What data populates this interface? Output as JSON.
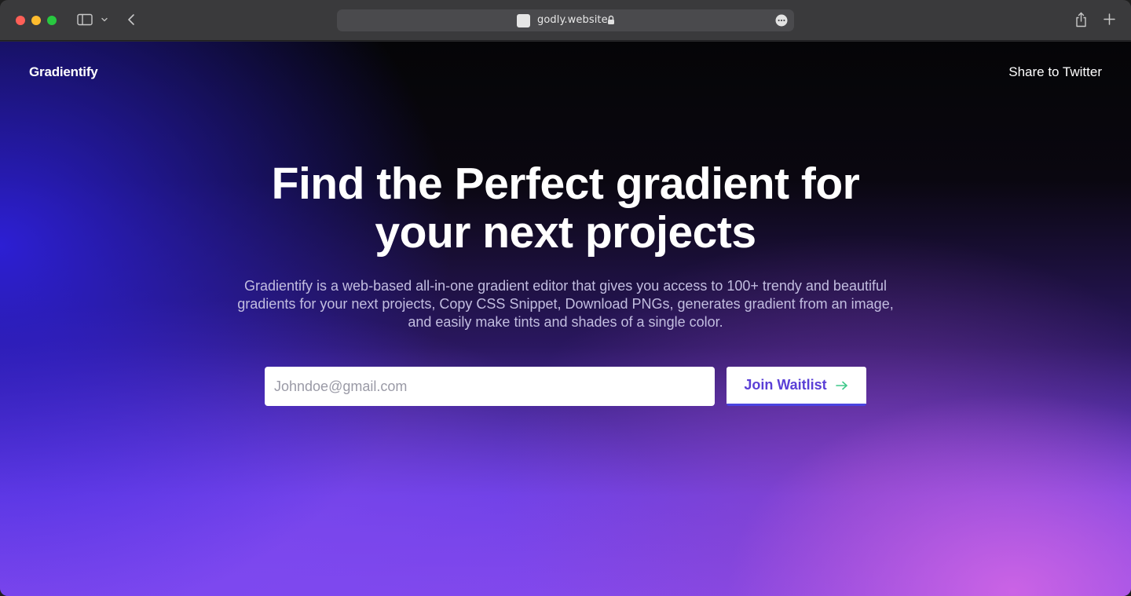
{
  "browser": {
    "url": "godly.website"
  },
  "nav": {
    "brand": "Gradientify",
    "share_link": "Share to Twitter"
  },
  "hero": {
    "title_line1": "Find the Perfect gradient for",
    "title_line2": "your next projects",
    "desc_line1": "Gradientify is a web-based all-in-one gradient editor that gives you access to 100+ trendy and beautiful",
    "desc_line2": "gradients for your next projects, Copy CSS Snippet, Download PNGs, generates gradient from an image,",
    "desc_line3": "and easily make tints and shades of a single color."
  },
  "form": {
    "email_placeholder": "Johndoe@gmail.com",
    "email_value": "",
    "submit_label": "Join Waitlist"
  },
  "colors": {
    "accent": "#5a3fd6",
    "arrow": "#3ec98a",
    "button_border": "#4a44e0"
  },
  "icons": [
    "sidebar-icon",
    "chevron-down-icon",
    "back-arrow-icon",
    "lock-icon",
    "more-icon",
    "share-icon",
    "plus-icon",
    "arrow-right-icon"
  ]
}
